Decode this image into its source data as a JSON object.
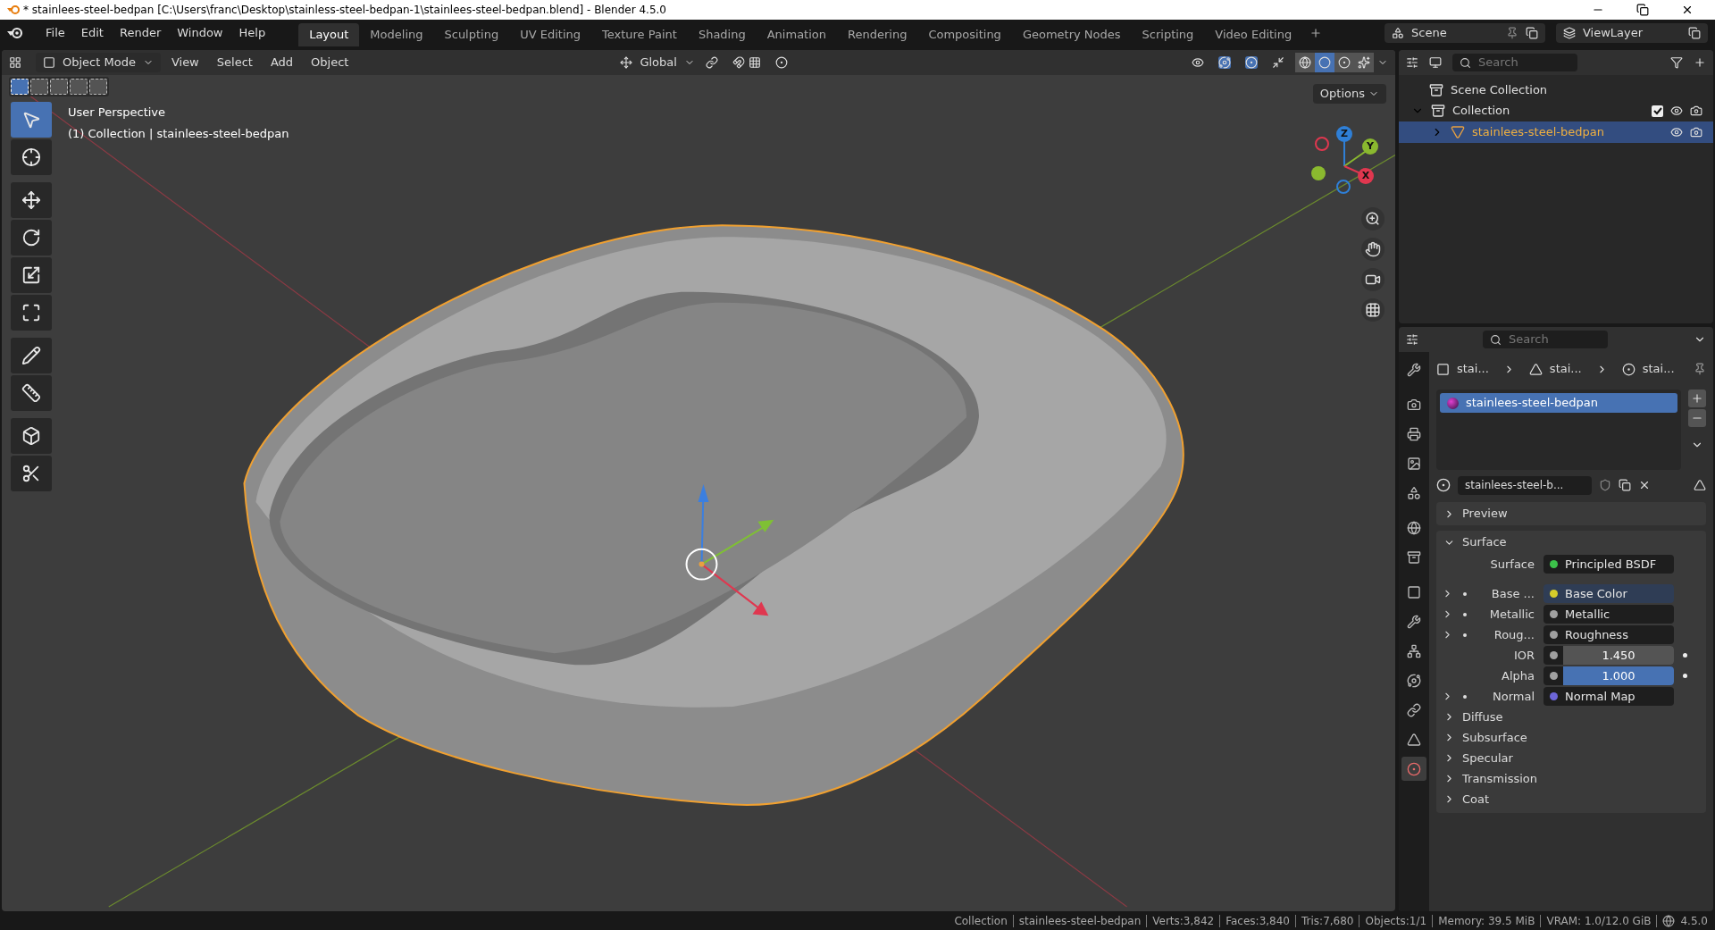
{
  "title_bar": {
    "title": "* stainlees-steel-bedpan [C:\\Users\\franc\\Desktop\\stainless-steel-bedpan-1\\stainlees-steel-bedpan.blend] - Blender 4.5.0"
  },
  "menu": [
    "File",
    "Edit",
    "Render",
    "Window",
    "Help"
  ],
  "workspaces": [
    {
      "label": "Layout",
      "selected": true
    },
    {
      "label": "Modeling",
      "selected": false
    },
    {
      "label": "Sculpting",
      "selected": false
    },
    {
      "label": "UV Editing",
      "selected": false
    },
    {
      "label": "Texture Paint",
      "selected": false
    },
    {
      "label": "Shading",
      "selected": false
    },
    {
      "label": "Animation",
      "selected": false
    },
    {
      "label": "Rendering",
      "selected": false
    },
    {
      "label": "Compositing",
      "selected": false
    },
    {
      "label": "Geometry Nodes",
      "selected": false
    },
    {
      "label": "Scripting",
      "selected": false
    },
    {
      "label": "Video Editing",
      "selected": false
    }
  ],
  "scene": "Scene",
  "view_layer": "ViewLayer",
  "viewport_header": {
    "mode": "Object Mode",
    "menus": [
      "View",
      "Select",
      "Add",
      "Object"
    ],
    "orientation": "Global",
    "shading_modes": [
      {
        "kind": "wireframe",
        "selected": false
      },
      {
        "kind": "solid",
        "selected": true
      },
      {
        "kind": "material",
        "selected": false
      },
      {
        "kind": "rendered",
        "selected": false
      }
    ]
  },
  "select_modes": [
    {
      "selected": true
    },
    {
      "selected": false
    },
    {
      "selected": false
    },
    {
      "selected": false
    },
    {
      "selected": false
    }
  ],
  "tools": [
    {
      "kind": "select",
      "selected": true
    },
    {
      "kind": "cursor",
      "selected": false
    },
    {
      "kind": "move",
      "selected": false
    },
    {
      "kind": "rotate",
      "selected": false
    },
    {
      "kind": "scale",
      "selected": false
    },
    {
      "kind": "transform",
      "selected": false
    },
    {
      "kind": "annotate",
      "selected": false
    },
    {
      "kind": "measure",
      "selected": false
    },
    {
      "kind": "add_cube",
      "selected": false
    },
    {
      "kind": "cut",
      "selected": false
    }
  ],
  "viewport": {
    "overlay_lines": [
      "User Perspective",
      "(1) Collection | stainlees-steel-bedpan"
    ],
    "options": "Options",
    "gizmo_axes": [
      {
        "label": "Z",
        "color": "#2f7fd6"
      },
      {
        "label": "Y",
        "color": "#8ab92f"
      },
      {
        "label": "X",
        "color": "#e0374f"
      }
    ]
  },
  "outliner": {
    "search_placeholder": "Search",
    "scene_collection": "Scene Collection",
    "children": [
      {
        "label": "Collection",
        "kind": "collection",
        "expanded": true,
        "checked": true,
        "selected": false,
        "children": [
          {
            "label": "stainlees-steel-bedpan",
            "kind": "mesh",
            "expanded": false,
            "selected": true
          }
        ]
      }
    ]
  },
  "properties": {
    "search_placeholder": "Search",
    "tabs": [
      {
        "kind": "tool",
        "selected": false
      },
      {
        "kind": "render",
        "selected": false
      },
      {
        "kind": "output",
        "selected": false
      },
      {
        "kind": "view_layer",
        "selected": false
      },
      {
        "kind": "scene",
        "selected": false
      },
      {
        "kind": "world",
        "selected": false
      },
      {
        "kind": "collection",
        "selected": false
      },
      {
        "kind": "object",
        "selected": false
      },
      {
        "kind": "modifier",
        "selected": false
      },
      {
        "kind": "particles",
        "selected": false
      },
      {
        "kind": "physics",
        "selected": false
      },
      {
        "kind": "constraints",
        "selected": false
      },
      {
        "kind": "data",
        "selected": false
      },
      {
        "kind": "material",
        "selected": true
      }
    ],
    "breadcrumb": [
      "stai...",
      "stai...",
      "stai..."
    ],
    "material_slots": [
      {
        "label": "stainlees-steel-bedpan",
        "selected": true
      }
    ],
    "material_name": "stainlees-steel-b...",
    "panels": [
      {
        "label": "Preview",
        "expanded": false
      },
      {
        "label": "Surface",
        "expanded": true
      }
    ],
    "surface_rows": [
      {
        "kind": "shader",
        "label": "Surface",
        "value": "Principled BSDF",
        "color": "#3cc24a",
        "highlighted": false
      },
      {
        "kind": "link",
        "label": "Base ...",
        "value": "Base Color",
        "color": "#d6cc2a",
        "highlighted": true
      },
      {
        "kind": "link",
        "label": "Metallic",
        "value": "Metallic",
        "color": "#a0a0a0",
        "highlighted": false
      },
      {
        "kind": "link",
        "label": "Roug...",
        "value": "Roughness",
        "color": "#a0a0a0",
        "highlighted": false
      },
      {
        "kind": "number",
        "label": "IOR",
        "value": "1.450",
        "color": "#a0a0a0",
        "highlighted": false
      },
      {
        "kind": "slider",
        "label": "Alpha",
        "value": "1.000",
        "color": "#a0a0a0",
        "level": 1,
        "highlighted": false
      },
      {
        "kind": "link",
        "label": "Normal",
        "value": "Normal Map",
        "color": "#6d66d8",
        "highlighted": false
      }
    ],
    "subpanels": [
      {
        "label": "Diffuse",
        "expanded": false
      },
      {
        "label": "Subsurface",
        "expanded": false
      },
      {
        "label": "Specular",
        "expanded": false
      },
      {
        "label": "Transmission",
        "expanded": false
      },
      {
        "label": "Coat",
        "expanded": false
      }
    ]
  },
  "status_bar": [
    "Collection",
    "stainlees-steel-bedpan",
    "Verts:3,842",
    "Faces:3,840",
    "Tris:7,680",
    "Objects:1/1",
    "Memory: 39.5 MiB",
    "VRAM: 1.0/12.0 GiB",
    "4.5.0"
  ]
}
